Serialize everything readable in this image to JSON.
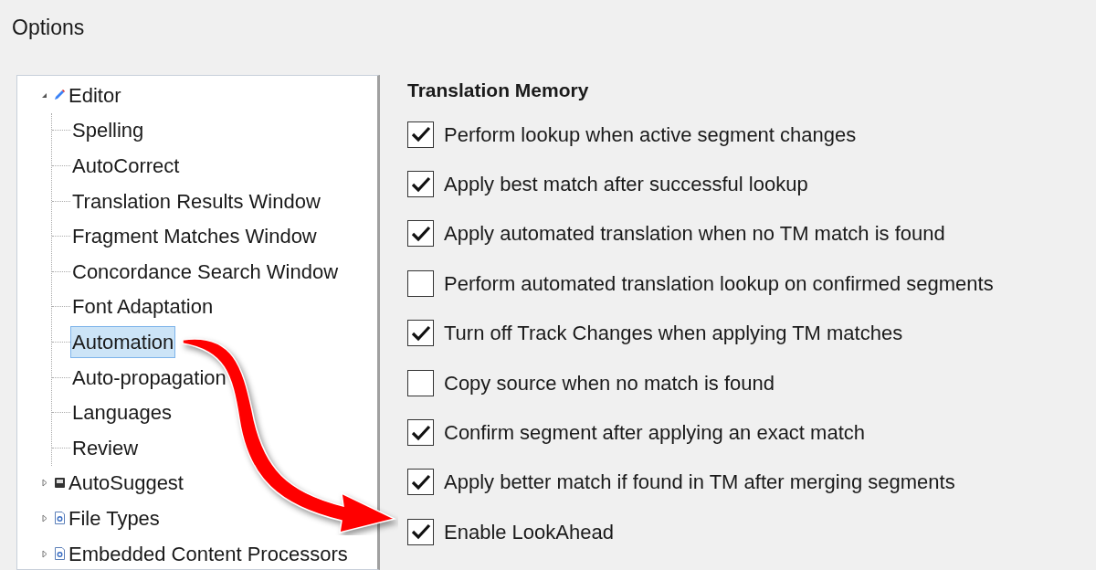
{
  "window": {
    "title": "Options"
  },
  "tree": {
    "items": [
      {
        "label": "Editor",
        "kind": "pencil",
        "expanded": true,
        "children": [
          {
            "label": "Spelling",
            "selected": false
          },
          {
            "label": "AutoCorrect",
            "selected": false
          },
          {
            "label": "Translation Results Window",
            "selected": false
          },
          {
            "label": "Fragment Matches Window",
            "selected": false
          },
          {
            "label": "Concordance Search Window",
            "selected": false
          },
          {
            "label": "Font Adaptation",
            "selected": false
          },
          {
            "label": "Automation",
            "selected": true
          },
          {
            "label": "Auto-propagation",
            "selected": false
          },
          {
            "label": "Languages",
            "selected": false
          },
          {
            "label": "Review",
            "selected": false
          }
        ]
      },
      {
        "label": "AutoSuggest",
        "kind": "square",
        "expanded": false
      },
      {
        "label": "File Types",
        "kind": "document",
        "expanded": false
      },
      {
        "label": "Embedded Content Processors",
        "kind": "document",
        "expanded": false
      }
    ]
  },
  "section": {
    "heading": "Translation Memory",
    "options": [
      {
        "label": "Perform lookup when active segment changes",
        "checked": true
      },
      {
        "label": "Apply best match after successful lookup",
        "checked": true
      },
      {
        "label": "Apply automated translation when no TM match is found",
        "checked": true
      },
      {
        "label": "Perform automated translation lookup on confirmed segments",
        "checked": false
      },
      {
        "label": "Turn off Track Changes when applying TM matches",
        "checked": true
      },
      {
        "label": "Copy source when no match is found",
        "checked": false
      },
      {
        "label": "Confirm segment after applying an exact match",
        "checked": true
      },
      {
        "label": "Apply better match if found in TM after merging segments",
        "checked": true
      },
      {
        "label": "Enable LookAhead",
        "checked": true
      }
    ]
  }
}
